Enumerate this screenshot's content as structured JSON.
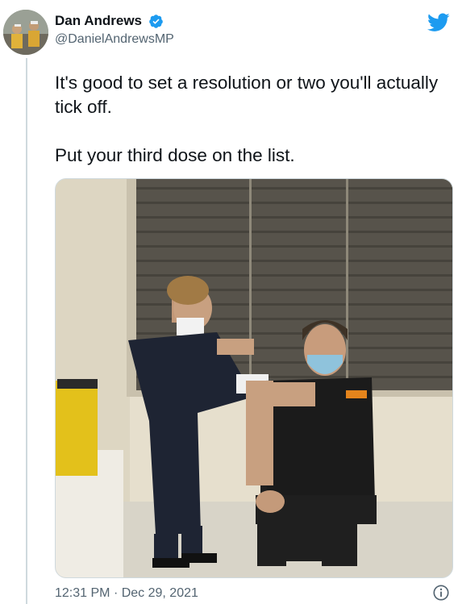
{
  "tweet": {
    "display_name": "Dan Andrews",
    "handle": "@DanielAndrewsMP",
    "text": [
      "It's good to set a resolution or two you'll actually tick off.",
      "Put your third dose on the list."
    ],
    "time": "12:31 PM",
    "separator": "·",
    "date": "Dec 29, 2021"
  },
  "icons": {
    "verified": "verified-badge-icon",
    "brand": "twitter-bird-icon",
    "info": "info-icon"
  },
  "colors": {
    "accent": "#1d9bf0",
    "text": "#0f1419",
    "secondary": "#536471",
    "border": "#cfd9de"
  }
}
